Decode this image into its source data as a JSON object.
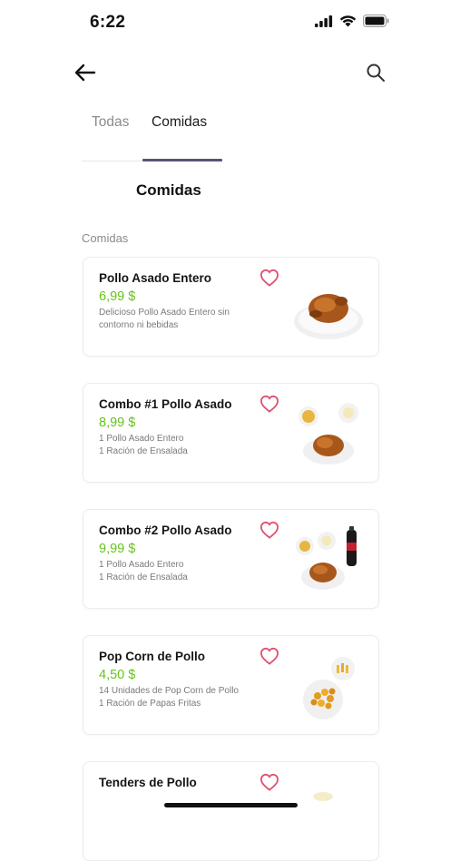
{
  "status_bar": {
    "time": "6:22"
  },
  "tabs": [
    {
      "label": "Todas",
      "active": false
    },
    {
      "label": "Comidas",
      "active": true
    }
  ],
  "section": {
    "title": "Comidas",
    "subtitle": "Comidas"
  },
  "products": [
    {
      "name": "Pollo Asado Entero",
      "price": "6,99 $",
      "description_lines": [
        "Delicioso Pollo Asado Entero sin",
        "contorno ni bebidas"
      ],
      "image": "roast-chicken-plate"
    },
    {
      "name": "Combo #1 Pollo Asado",
      "price": "8,99 $",
      "description_lines": [
        "1 Pollo Asado Entero",
        "1 Ración de Ensalada"
      ],
      "image": "chicken-combo-salad"
    },
    {
      "name": "Combo #2 Pollo Asado",
      "price": "9,99 $",
      "description_lines": [
        "1 Pollo Asado Entero",
        "1 Ración de Ensalada"
      ],
      "image": "chicken-combo-soda"
    },
    {
      "name": "Pop Corn de Pollo",
      "price": "4,50 $",
      "description_lines": [
        "14 Unidades de Pop Corn de Pollo",
        "1 Ración de Papas Fritas"
      ],
      "image": "popcorn-chicken-fries"
    },
    {
      "name": "Tenders de Pollo",
      "price": "",
      "description_lines": [
        "",
        ""
      ],
      "image": "chicken-tenders"
    }
  ],
  "colors": {
    "price": "#65c418",
    "heart": "#e0516f",
    "tab_indicator": "#55557a"
  },
  "icons": [
    "back-arrow-icon",
    "search-icon",
    "heart-icon"
  ]
}
